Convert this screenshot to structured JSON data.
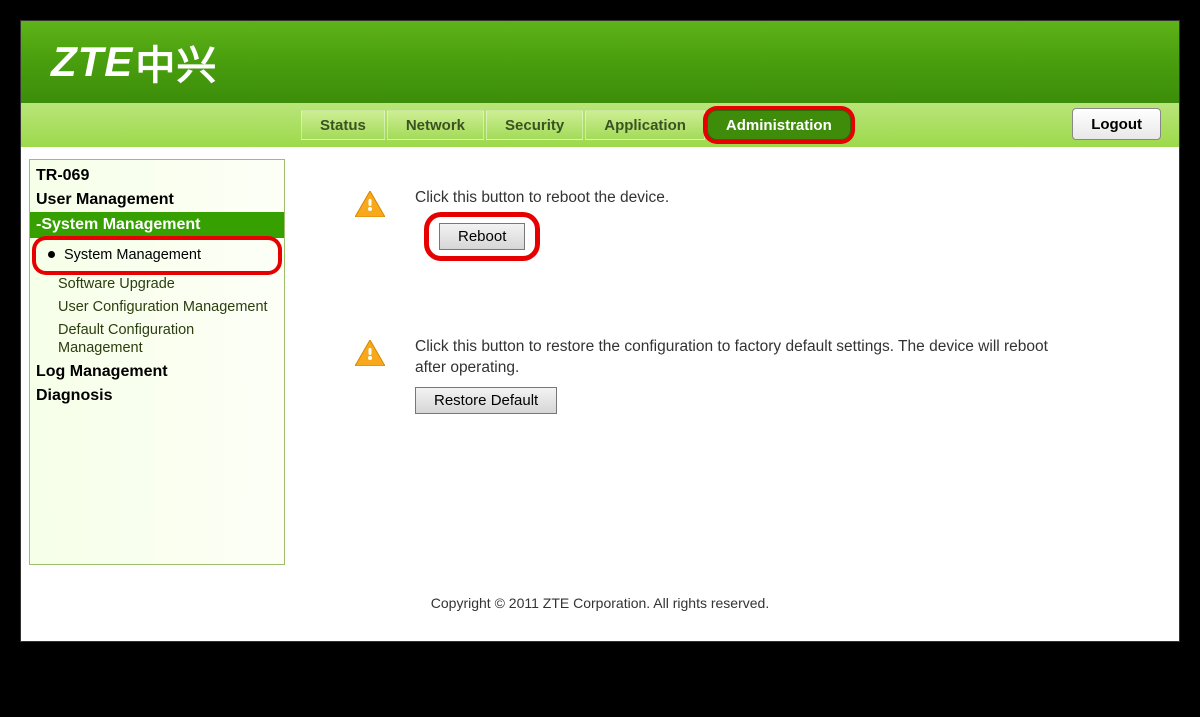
{
  "brand": {
    "logo_latin": "ZTE",
    "logo_cn": "中兴"
  },
  "nav": {
    "tabs": [
      {
        "label": "Status"
      },
      {
        "label": "Network"
      },
      {
        "label": "Security"
      },
      {
        "label": "Application"
      },
      {
        "label": "Administration"
      }
    ],
    "logout": "Logout"
  },
  "sidebar": {
    "items": [
      {
        "label": "TR-069"
      },
      {
        "label": "User Management"
      }
    ],
    "section": {
      "label": "-System Management"
    },
    "subs": [
      {
        "label": "System Management"
      },
      {
        "label": "Software Upgrade"
      },
      {
        "label": "User Configuration Management"
      },
      {
        "label": "Default Configuration Management"
      }
    ],
    "tail": [
      {
        "label": "Log Management"
      },
      {
        "label": "Diagnosis"
      }
    ]
  },
  "content": {
    "reboot_text": "Click this button to reboot the device.",
    "reboot_btn": "Reboot",
    "restore_text": "Click this button to restore the configuration to factory default settings. The device will reboot after operating.",
    "restore_btn": "Restore Default"
  },
  "footer": "Copyright © 2011 ZTE Corporation. All rights reserved."
}
